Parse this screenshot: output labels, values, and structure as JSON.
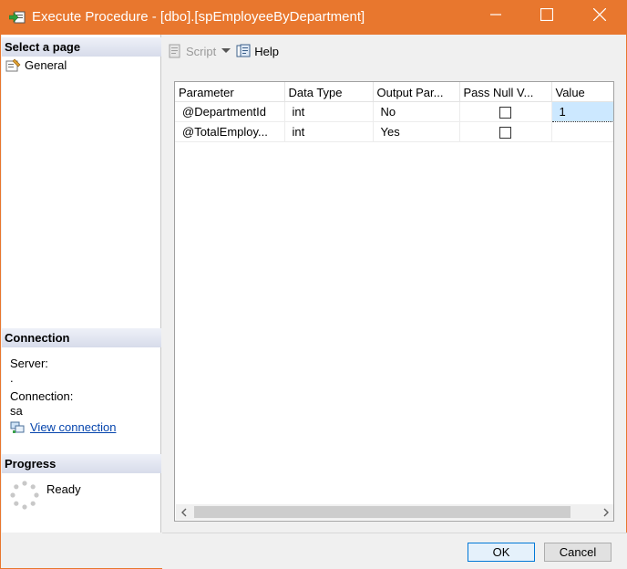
{
  "window": {
    "title": "Execute Procedure - [dbo].[spEmployeeByDepartment]",
    "accent_color": "#e8772e"
  },
  "sidebar": {
    "select_page_header": "Select a page",
    "pages": [
      {
        "label": "General",
        "icon": "properties-page-icon"
      }
    ],
    "connection_header": "Connection",
    "server_label": "Server:",
    "server_value": ".",
    "connection_label": "Connection:",
    "connection_value": "sa",
    "view_connection_link": "View connection",
    "progress_header": "Progress",
    "progress_status": "Ready"
  },
  "toolbar": {
    "script_label": "Script",
    "help_label": "Help"
  },
  "grid": {
    "columns": [
      "Parameter",
      "Data Type",
      "Output Par...",
      "Pass Null V...",
      "Value"
    ],
    "rows": [
      {
        "parameter": "@DepartmentId",
        "data_type": "int",
        "output": "No",
        "pass_null": false,
        "value": "1"
      },
      {
        "parameter": "@TotalEmploy...",
        "data_type": "int",
        "output": "Yes",
        "pass_null": false,
        "value": ""
      }
    ]
  },
  "buttons": {
    "ok": "OK",
    "cancel": "Cancel"
  }
}
